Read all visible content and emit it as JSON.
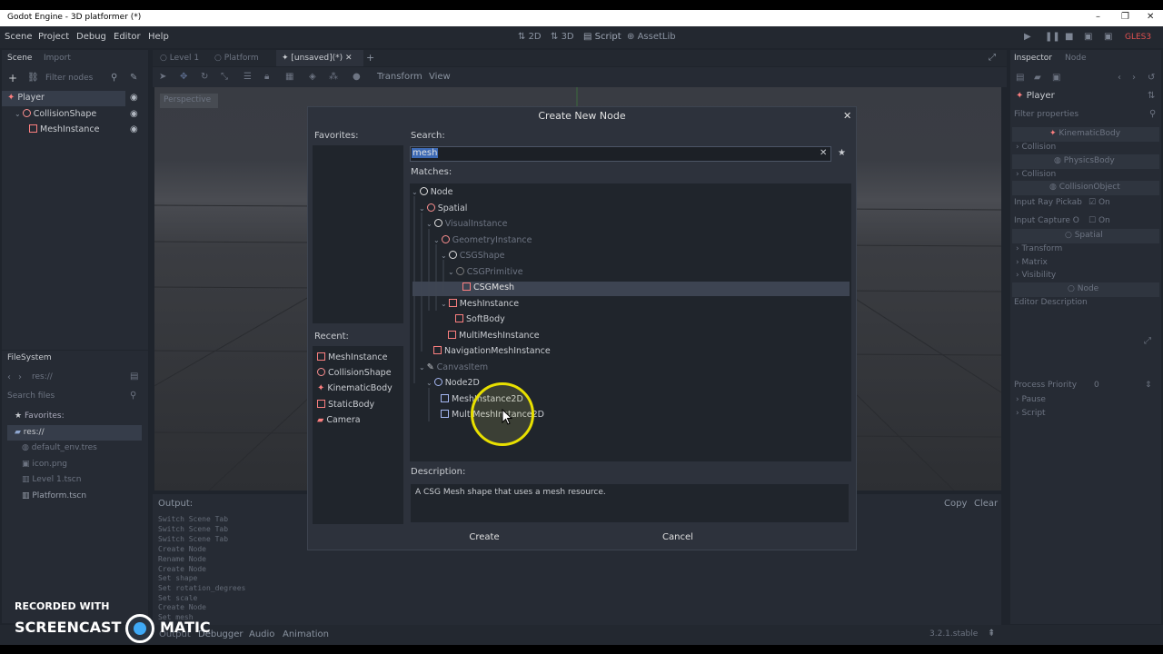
{
  "window": {
    "title": "Godot Engine - 3D platformer (*)",
    "minimize": "–",
    "maximize": "❐",
    "close": "✕"
  },
  "menu": {
    "scene": "Scene",
    "project": "Project",
    "debug": "Debug",
    "editor": "Editor",
    "help": "Help"
  },
  "workspaces": {
    "w2d": "2D",
    "w3d": "3D",
    "script": "Script",
    "assetlib": "AssetLib"
  },
  "renderer": "GLES3",
  "scene_dock": {
    "tab_scene": "Scene",
    "tab_import": "Import",
    "filter_placeholder": "Filter nodes",
    "nodes": [
      "Player",
      "CollisionShape",
      "MeshInstance"
    ]
  },
  "editor_tabs": [
    "Level 1",
    "Platform",
    "[unsaved](*)"
  ],
  "toolbar": {
    "transform": "Transform",
    "view": "View",
    "perspective": "Perspective"
  },
  "filesystem": {
    "title": "FileSystem",
    "path": "res://",
    "search_placeholder": "Search files",
    "favorites": "Favorites:",
    "root": "res://",
    "files": [
      "default_env.tres",
      "icon.png",
      "Level 1.tscn",
      "Platform.tscn"
    ]
  },
  "output": {
    "label": "Output:",
    "copy": "Copy",
    "clear": "Clear",
    "lines": [
      "Switch Scene Tab",
      "Switch Scene Tab",
      "Switch Scene Tab",
      "Create Node",
      "Rename Node",
      "Create Node",
      "Set shape",
      "Set rotation_degrees",
      "Set scale",
      "Create Node",
      "Set mesh"
    ],
    "bottom_tabs": [
      "Output",
      "Debugger",
      "Audio",
      "Animation"
    ],
    "version": "3.2.1.stable"
  },
  "inspector": {
    "tab_inspector": "Inspector",
    "tab_node": "Node",
    "object": "Player",
    "filter_placeholder": "Filter properties",
    "kinematic": "KinematicBody",
    "collision": "Collision",
    "physicsbody": "PhysicsBody",
    "collision2": "Collision",
    "collisionobject": "CollisionObject",
    "input_ray_pickable": "Input Ray Pickab",
    "on1": "On",
    "input_capture": "Input Capture O",
    "on2": "On",
    "spatial": "Spatial",
    "transform": "Transform",
    "matrix": "Matrix",
    "visibility": "Visibility",
    "node": "Node",
    "editor_description": "Editor Description",
    "process_priority": "Process Priority",
    "process_priority_value": "0",
    "pause": "Pause",
    "script": "Script"
  },
  "dialog": {
    "title": "Create New Node",
    "favorites": "Favorites:",
    "recent": "Recent:",
    "search_label": "Search:",
    "search_value": "mesh",
    "matches_label": "Matches:",
    "description_label": "Description:",
    "description": "A CSG Mesh shape that uses a mesh resource.",
    "create": "Create",
    "cancel": "Cancel",
    "recent_items": [
      "MeshInstance",
      "CollisionShape",
      "KinematicBody",
      "StaticBody",
      "Camera"
    ],
    "tree": {
      "node": "Node",
      "spatial": "Spatial",
      "visualinstance": "VisualInstance",
      "geometryinstance": "GeometryInstance",
      "csgshape": "CSGShape",
      "csgprimitive": "CSGPrimitive",
      "csgmesh": "CSGMesh",
      "meshinstance": "MeshInstance",
      "softbody": "SoftBody",
      "multimeshinstance": "MultiMeshInstance",
      "navmesh": "NavigationMeshInstance",
      "canvasitem": "CanvasItem",
      "node2d": "Node2D",
      "meshinstance2d": "MeshInstance2D",
      "multimeshinstance2d": "MultiMeshInstance2D"
    }
  },
  "watermark": {
    "line1": "RECORDED WITH",
    "left": "SCREENCAST",
    "right": "MATIC"
  }
}
